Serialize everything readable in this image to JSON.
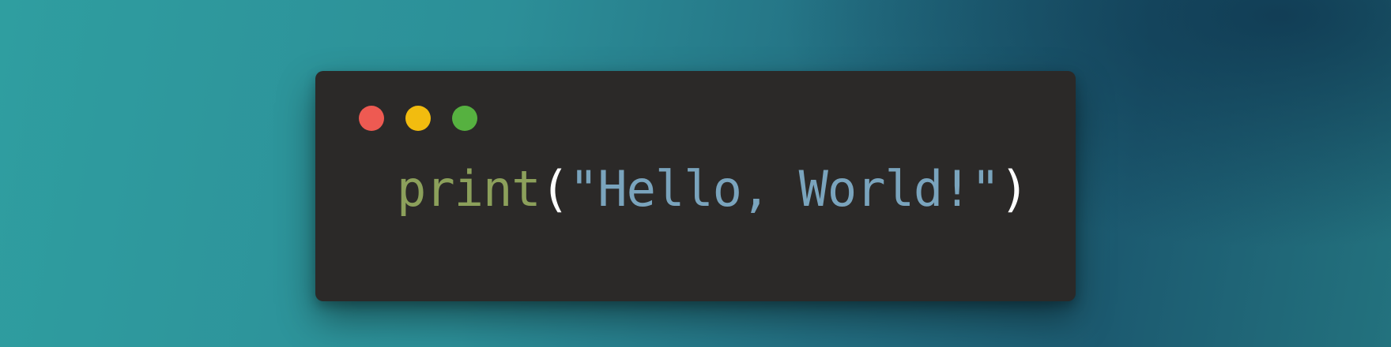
{
  "colors": {
    "window_bg": "#2b2928",
    "traffic_close": "#ee5a52",
    "traffic_minimize": "#f2bc0f",
    "traffic_maximize": "#56b140",
    "keyword": "#8ca05b",
    "paren": "#ffffff",
    "string": "#7aa4bd"
  },
  "window": {
    "controls": [
      {
        "name": "close",
        "icon": "red-circle"
      },
      {
        "name": "minimize",
        "icon": "yellow-circle"
      },
      {
        "name": "maximize",
        "icon": "green-circle"
      }
    ]
  },
  "code": {
    "function_name": "print",
    "open_paren": "(",
    "string_literal": "\"Hello, World!\"",
    "close_paren": ")"
  }
}
